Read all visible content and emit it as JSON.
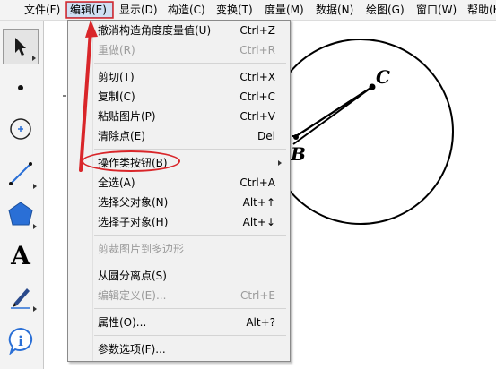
{
  "menubar": {
    "items": [
      {
        "label": "文件(F)"
      },
      {
        "label": "编辑(E)"
      },
      {
        "label": "显示(D)"
      },
      {
        "label": "构造(C)"
      },
      {
        "label": "变换(T)"
      },
      {
        "label": "度量(M)"
      },
      {
        "label": "数据(N)"
      },
      {
        "label": "绘图(G)"
      },
      {
        "label": "窗口(W)"
      },
      {
        "label": "帮助(H)"
      }
    ]
  },
  "toolbox": {
    "tools": [
      {
        "icon": "arrow-select-icon"
      },
      {
        "icon": "point-icon"
      },
      {
        "icon": "compass-circle-icon"
      },
      {
        "icon": "line-segment-icon"
      },
      {
        "icon": "polygon-icon"
      },
      {
        "icon": "text-tool-icon",
        "glyph": "A"
      },
      {
        "icon": "marker-pen-icon"
      },
      {
        "icon": "information-icon",
        "glyph": "i"
      }
    ]
  },
  "edit_menu": {
    "items": [
      {
        "label": "撤消构造角度度量值(U)",
        "shortcut": "Ctrl+Z",
        "enabled": true
      },
      {
        "label": "重做(R)",
        "shortcut": "Ctrl+R",
        "enabled": false
      },
      {
        "label": "剪切(T)",
        "shortcut": "Ctrl+X",
        "enabled": true
      },
      {
        "label": "复制(C)",
        "shortcut": "Ctrl+C",
        "enabled": true
      },
      {
        "label": "粘贴图片(P)",
        "shortcut": "Ctrl+V",
        "enabled": true
      },
      {
        "label": "清除点(E)",
        "shortcut": "Del",
        "enabled": true
      },
      {
        "label": "操作类按钮(B)",
        "shortcut": "",
        "enabled": true,
        "submenu": true
      },
      {
        "label": "全选(A)",
        "shortcut": "Ctrl+A",
        "enabled": true
      },
      {
        "label": "选择父对象(N)",
        "shortcut": "Alt+↑",
        "enabled": true
      },
      {
        "label": "选择子对象(H)",
        "shortcut": "Alt+↓",
        "enabled": true
      },
      {
        "label": "剪裁图片到多边形",
        "shortcut": "",
        "enabled": false
      },
      {
        "label": "从圆分离点(S)",
        "shortcut": "",
        "enabled": true
      },
      {
        "label": "编辑定义(E)...",
        "shortcut": "Ctrl+E",
        "enabled": false
      },
      {
        "label": "属性(O)...",
        "shortcut": "Alt+?",
        "enabled": true
      },
      {
        "label": "参数选项(F)...",
        "shortcut": "",
        "enabled": true
      }
    ]
  },
  "canvas": {
    "point_labels": {
      "c": "C",
      "b": "B"
    }
  },
  "colors": {
    "annotation_red": "#d9262a",
    "menu_highlight": "#cfe0f3",
    "tool_blue": "#2a6fd6"
  }
}
